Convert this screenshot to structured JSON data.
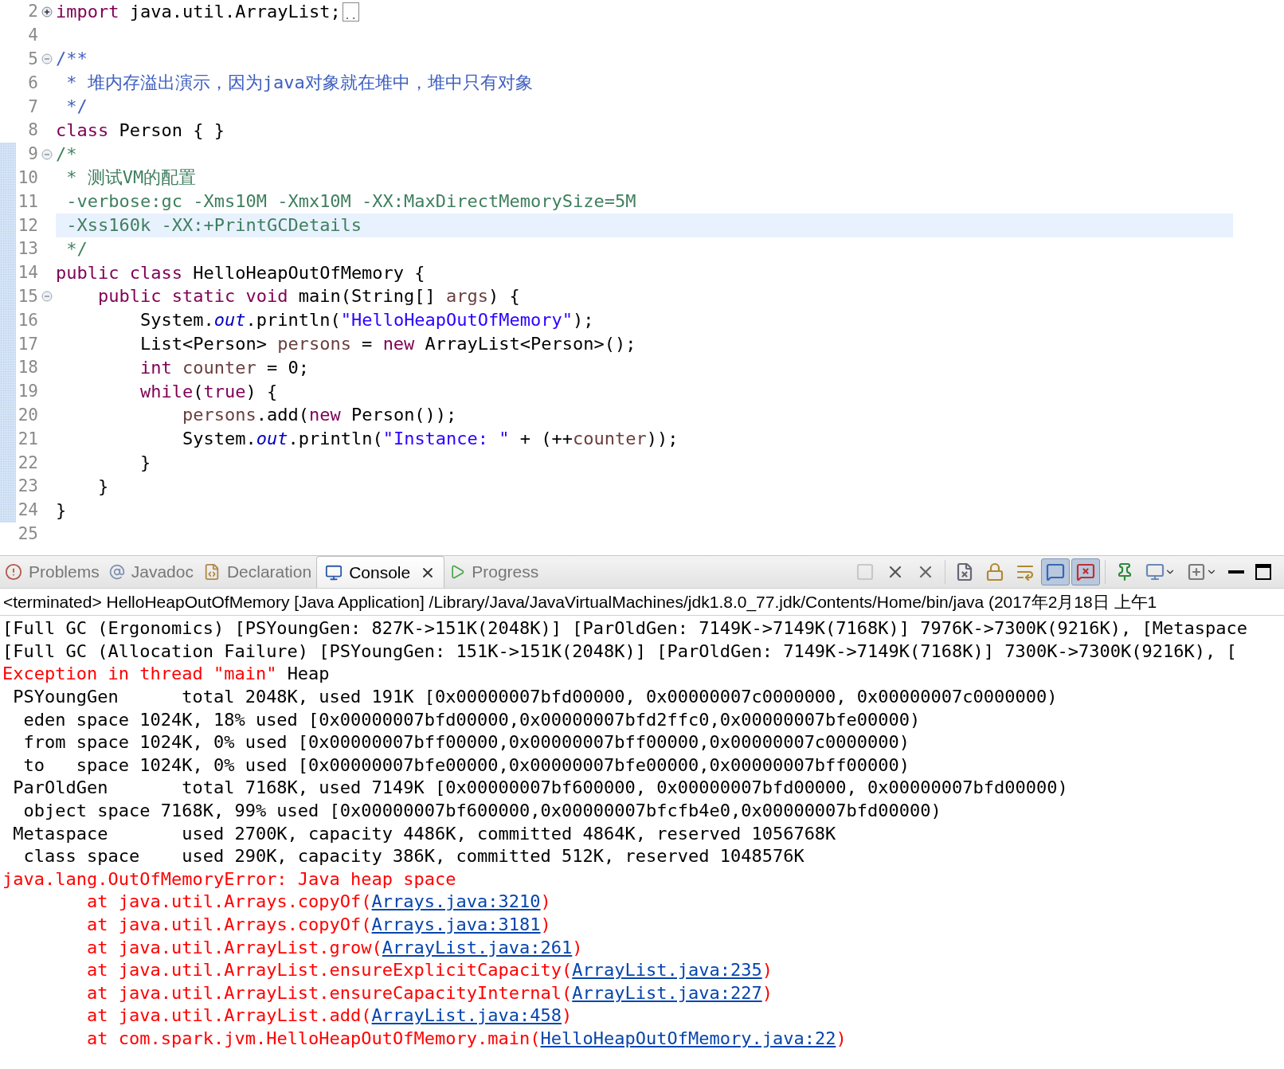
{
  "editor": {
    "lines": [
      {
        "number": "2",
        "expanded": false,
        "changed": false,
        "current": false,
        "tokens": [
          {
            "kind": "keyword",
            "text": "import"
          },
          {
            "kind": "plain",
            "text": " java.util.ArrayList;"
          },
          {
            "kind": "folded",
            "text": ".."
          }
        ]
      },
      {
        "number": "4",
        "changed": false,
        "current": false
      },
      {
        "number": "5",
        "expanded": true,
        "changed": false,
        "current": false,
        "tokens": [
          {
            "kind": "javadoc",
            "text": "/**"
          }
        ]
      },
      {
        "number": "6",
        "changed": false,
        "current": false,
        "tokens": [
          {
            "kind": "javadoc",
            "text": " * 堆内存溢出演示，因为java对象就在堆中，堆中只有对象"
          }
        ]
      },
      {
        "number": "7",
        "changed": false,
        "current": false,
        "tokens": [
          {
            "kind": "javadoc",
            "text": " */"
          }
        ]
      },
      {
        "number": "8",
        "changed": false,
        "current": false,
        "tokens": [
          {
            "kind": "keyword",
            "text": "class"
          },
          {
            "kind": "plain",
            "text": " Person { }"
          }
        ]
      },
      {
        "number": "9",
        "expanded": true,
        "changed": true,
        "current": false,
        "tokens": [
          {
            "kind": "comment",
            "text": "/*"
          }
        ]
      },
      {
        "number": "10",
        "changed": true,
        "current": false,
        "tokens": [
          {
            "kind": "comment",
            "text": " * 测试VM的配置"
          }
        ]
      },
      {
        "number": "11",
        "changed": true,
        "current": false,
        "tokens": [
          {
            "kind": "comment",
            "text": " -verbose:gc -Xms10M -Xmx10M -XX:MaxDirectMemorySize=5M"
          }
        ]
      },
      {
        "number": "12",
        "changed": true,
        "current": true,
        "tokens": [
          {
            "kind": "comment",
            "text": " -Xss160k -XX:+PrintGCDetails"
          }
        ]
      },
      {
        "number": "13",
        "changed": true,
        "current": false,
        "tokens": [
          {
            "kind": "comment",
            "text": " */"
          }
        ]
      },
      {
        "number": "14",
        "changed": true,
        "current": false,
        "tokens": [
          {
            "kind": "keyword",
            "text": "public class"
          },
          {
            "kind": "plain",
            "text": " HelloHeapOutOfMemory {"
          }
        ]
      },
      {
        "number": "15",
        "expanded": true,
        "changed": true,
        "current": false,
        "tokens": [
          {
            "kind": "keyword",
            "text": "    public static void"
          },
          {
            "kind": "plain",
            "text": " main(String[] "
          },
          {
            "kind": "variable",
            "text": "args"
          },
          {
            "kind": "plain",
            "text": ") {"
          }
        ]
      },
      {
        "number": "16",
        "changed": true,
        "current": false,
        "tokens": [
          {
            "kind": "plain",
            "text": "        System."
          },
          {
            "kind": "field",
            "text": "out"
          },
          {
            "kind": "plain",
            "text": ".println("
          },
          {
            "kind": "string",
            "text": "\"HelloHeapOutOfMemory\""
          },
          {
            "kind": "plain",
            "text": ");"
          }
        ]
      },
      {
        "number": "17",
        "changed": true,
        "current": false,
        "tokens": [
          {
            "kind": "plain",
            "text": "        List<Person> "
          },
          {
            "kind": "variable",
            "text": "persons"
          },
          {
            "kind": "plain",
            "text": " = "
          },
          {
            "kind": "keyword",
            "text": "new"
          },
          {
            "kind": "plain",
            "text": " ArrayList<Person>();"
          }
        ]
      },
      {
        "number": "18",
        "changed": true,
        "current": false,
        "tokens": [
          {
            "kind": "keyword",
            "text": "        int"
          },
          {
            "kind": "variable",
            "text": " counter"
          },
          {
            "kind": "plain",
            "text": " = 0;"
          }
        ]
      },
      {
        "number": "19",
        "changed": true,
        "current": false,
        "tokens": [
          {
            "kind": "keyword",
            "text": "        while"
          },
          {
            "kind": "plain",
            "text": "("
          },
          {
            "kind": "keyword",
            "text": "true"
          },
          {
            "kind": "plain",
            "text": ") {"
          }
        ]
      },
      {
        "number": "20",
        "changed": true,
        "current": false,
        "tokens": [
          {
            "kind": "variable",
            "text": "            persons"
          },
          {
            "kind": "plain",
            "text": ".add("
          },
          {
            "kind": "keyword",
            "text": "new"
          },
          {
            "kind": "plain",
            "text": " Person());"
          }
        ]
      },
      {
        "number": "21",
        "changed": true,
        "current": false,
        "tokens": [
          {
            "kind": "plain",
            "text": "            System."
          },
          {
            "kind": "field",
            "text": "out"
          },
          {
            "kind": "plain",
            "text": ".println("
          },
          {
            "kind": "string",
            "text": "\"Instance: \""
          },
          {
            "kind": "plain",
            "text": " + (++"
          },
          {
            "kind": "variable",
            "text": "counter"
          },
          {
            "kind": "plain",
            "text": "));"
          }
        ]
      },
      {
        "number": "22",
        "changed": true,
        "current": false,
        "tokens": [
          {
            "kind": "plain",
            "text": "        }"
          }
        ]
      },
      {
        "number": "23",
        "changed": true,
        "current": false,
        "tokens": [
          {
            "kind": "plain",
            "text": "    }"
          }
        ]
      },
      {
        "number": "24",
        "changed": true,
        "current": false,
        "tokens": [
          {
            "kind": "plain",
            "text": "}"
          }
        ]
      },
      {
        "number": "25",
        "changed": false,
        "current": false
      }
    ]
  },
  "tabs": [
    {
      "kind": "problems",
      "label": "Problems",
      "selected": false
    },
    {
      "kind": "javadoc",
      "label": "Javadoc",
      "selected": false
    },
    {
      "kind": "declaration",
      "label": "Declaration",
      "selected": false
    },
    {
      "kind": "console",
      "label": "Console",
      "selected": true
    },
    {
      "kind": "progress",
      "label": "Progress",
      "selected": false
    }
  ],
  "toolbar": [
    {
      "kind": "stop",
      "disabled": true,
      "pressed": false
    },
    {
      "kind": "remove",
      "disabled": false,
      "pressed": false
    },
    {
      "kind": "remove-all",
      "disabled": false,
      "pressed": false
    },
    {
      "kind": "separator"
    },
    {
      "kind": "clear",
      "disabled": false,
      "pressed": false
    },
    {
      "kind": "scroll-lock",
      "disabled": false,
      "pressed": false
    },
    {
      "kind": "word-wrap",
      "disabled": false,
      "pressed": false
    },
    {
      "kind": "show-on-output",
      "disabled": false,
      "pressed": true
    },
    {
      "kind": "show-on-error",
      "disabled": false,
      "pressed": true
    },
    {
      "kind": "separator"
    },
    {
      "kind": "pin",
      "disabled": false,
      "pressed": false
    },
    {
      "kind": "display-console",
      "disabled": false,
      "pressed": false
    },
    {
      "kind": "open-console",
      "disabled": false,
      "pressed": false
    },
    {
      "kind": "minimize",
      "disabled": false,
      "pressed": false
    },
    {
      "kind": "maximize",
      "disabled": false,
      "pressed": false
    }
  ],
  "console": {
    "header": "<terminated> HelloHeapOutOfMemory [Java Application] /Library/Java/JavaVirtualMachines/jdk1.8.0_77.jdk/Contents/Home/bin/java (2017年2月18日 上午1",
    "lines": [
      [
        {
          "kind": "out",
          "text": "[Full GC (Ergonomics) [PSYoungGen: 827K->151K(2048K)] [ParOldGen: 7149K->7149K(7168K)] 7976K->7300K(9216K), [Metaspace"
        }
      ],
      [
        {
          "kind": "out",
          "text": "[Full GC (Allocation Failure) [PSYoungGen: 151K->151K(2048K)] [ParOldGen: 7149K->7149K(7168K)] 7300K->7300K(9216K), ["
        }
      ],
      [
        {
          "kind": "err",
          "text": "Exception in thread \"main\" "
        },
        {
          "kind": "out",
          "text": "Heap"
        }
      ],
      [
        {
          "kind": "out",
          "text": " PSYoungGen      total 2048K, used 191K [0x00000007bfd00000, 0x00000007c0000000, 0x00000007c0000000)"
        }
      ],
      [
        {
          "kind": "out",
          "text": "  eden space 1024K, 18% used [0x00000007bfd00000,0x00000007bfd2ffc0,0x00000007bfe00000)"
        }
      ],
      [
        {
          "kind": "out",
          "text": "  from space 1024K, 0% used [0x00000007bff00000,0x00000007bff00000,0x00000007c0000000)"
        }
      ],
      [
        {
          "kind": "out",
          "text": "  to   space 1024K, 0% used [0x00000007bfe00000,0x00000007bfe00000,0x00000007bff00000)"
        }
      ],
      [
        {
          "kind": "out",
          "text": " ParOldGen       total 7168K, used 7149K [0x00000007bf600000, 0x00000007bfd00000, 0x00000007bfd00000)"
        }
      ],
      [
        {
          "kind": "out",
          "text": "  object space 7168K, 99% used [0x00000007bf600000,0x00000007bfcfb4e0,0x00000007bfd00000)"
        }
      ],
      [
        {
          "kind": "out",
          "text": " Metaspace       used 2700K, capacity 4486K, committed 4864K, reserved 1056768K"
        }
      ],
      [
        {
          "kind": "out",
          "text": "  class space    used 290K, capacity 386K, committed 512K, reserved 1048576K"
        }
      ],
      [
        {
          "kind": "err",
          "text": "java.lang.OutOfMemoryError: Java heap space"
        }
      ],
      [
        {
          "kind": "err",
          "text": "\tat java.util.Arrays.copyOf("
        },
        {
          "kind": "link",
          "text": "Arrays.java:3210"
        },
        {
          "kind": "err",
          "text": ")"
        }
      ],
      [
        {
          "kind": "err",
          "text": "\tat java.util.Arrays.copyOf("
        },
        {
          "kind": "link",
          "text": "Arrays.java:3181"
        },
        {
          "kind": "err",
          "text": ")"
        }
      ],
      [
        {
          "kind": "err",
          "text": "\tat java.util.ArrayList.grow("
        },
        {
          "kind": "link",
          "text": "ArrayList.java:261"
        },
        {
          "kind": "err",
          "text": ")"
        }
      ],
      [
        {
          "kind": "err",
          "text": "\tat java.util.ArrayList.ensureExplicitCapacity("
        },
        {
          "kind": "link",
          "text": "ArrayList.java:235"
        },
        {
          "kind": "err",
          "text": ")"
        }
      ],
      [
        {
          "kind": "err",
          "text": "\tat java.util.ArrayList.ensureCapacityInternal("
        },
        {
          "kind": "link",
          "text": "ArrayList.java:227"
        },
        {
          "kind": "err",
          "text": ")"
        }
      ],
      [
        {
          "kind": "err",
          "text": "\tat java.util.ArrayList.add("
        },
        {
          "kind": "link",
          "text": "ArrayList.java:458"
        },
        {
          "kind": "err",
          "text": ")"
        }
      ],
      [
        {
          "kind": "err",
          "text": "\tat com.spark.jvm.HelloHeapOutOfMemory.main("
        },
        {
          "kind": "link",
          "text": "HelloHeapOutOfMemory.java:22"
        },
        {
          "kind": "err",
          "text": ")"
        }
      ]
    ]
  }
}
